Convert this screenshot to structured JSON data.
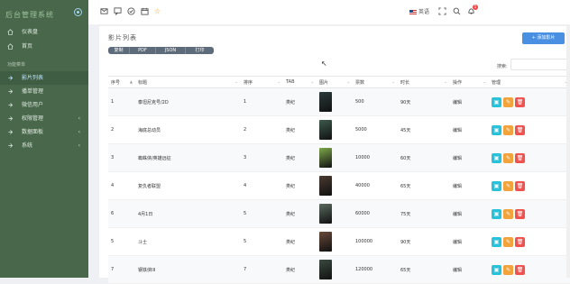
{
  "sidebar": {
    "brand": "后台管理系统",
    "items": [
      {
        "label": "仪表盘",
        "icon": "home-icon"
      },
      {
        "label": "首页",
        "icon": "home-icon"
      }
    ],
    "group": "功能菜单",
    "menu": [
      {
        "label": "影片列表",
        "icon": "list-icon",
        "active": true
      },
      {
        "label": "播单管理",
        "icon": "arrow-icon"
      },
      {
        "label": "微信用户",
        "icon": "arrow-icon"
      },
      {
        "label": "权限管理",
        "icon": "arrow-icon",
        "caret": "‹"
      },
      {
        "label": "数据面板",
        "icon": "arrow-icon",
        "caret": "‹"
      },
      {
        "label": "系统",
        "icon": "arrow-icon",
        "caret": "‹"
      }
    ]
  },
  "topbar": {
    "lang": "英语",
    "badge": "5"
  },
  "card": {
    "title": "影片列表",
    "add_label": "+ 添加影片",
    "exports": [
      "复制",
      "PDF",
      "JSON",
      "打印"
    ],
    "search_label": "搜索:",
    "columns": [
      "序号",
      "标题",
      "排序",
      "TAB",
      "图片",
      "票数",
      "时长",
      "操作",
      "管理"
    ],
    "rows": [
      {
        "n": "1",
        "title": "泰坦尼克号/2D",
        "sort": "1",
        "tab": "类纪",
        "votes": "500",
        "dur": "90天",
        "op": "编辑",
        "color": "#2b3a3a"
      },
      {
        "n": "2",
        "title": "海底总动员",
        "sort": "2",
        "tab": "类纪",
        "votes": "5000",
        "dur": "45天",
        "op": "编辑",
        "color": "#3c5a4c"
      },
      {
        "n": "3",
        "title": "蜘蛛侠/英雄远征",
        "sort": "3",
        "tab": "类纪",
        "votes": "10000",
        "dur": "60天",
        "op": "编辑",
        "color": "#7da84a"
      },
      {
        "n": "4",
        "title": "复仇者联盟",
        "sort": "4",
        "tab": "类纪",
        "votes": "40000",
        "dur": "65天",
        "op": "编辑",
        "color": "#4a3a30"
      },
      {
        "n": "6",
        "title": "4月1日",
        "sort": "5",
        "tab": "类纪",
        "votes": "60000",
        "dur": "75天",
        "op": "编辑",
        "color": "#5a6a60"
      },
      {
        "n": "5",
        "title": "斗士",
        "sort": "5",
        "tab": "类纪",
        "votes": "100000",
        "dur": "90天",
        "op": "编辑",
        "color": "#6a4a3a"
      },
      {
        "n": "7",
        "title": "钢铁侠III",
        "sort": "7",
        "tab": "类纪",
        "votes": "120000",
        "dur": "65天",
        "op": "编辑",
        "color": "#3a4a40"
      }
    ]
  },
  "colors": {
    "sidebar": "#48674b",
    "primary": "#4a90e2",
    "view": "#28c2da",
    "edit": "#f3a33b",
    "delete": "#ef5350"
  }
}
